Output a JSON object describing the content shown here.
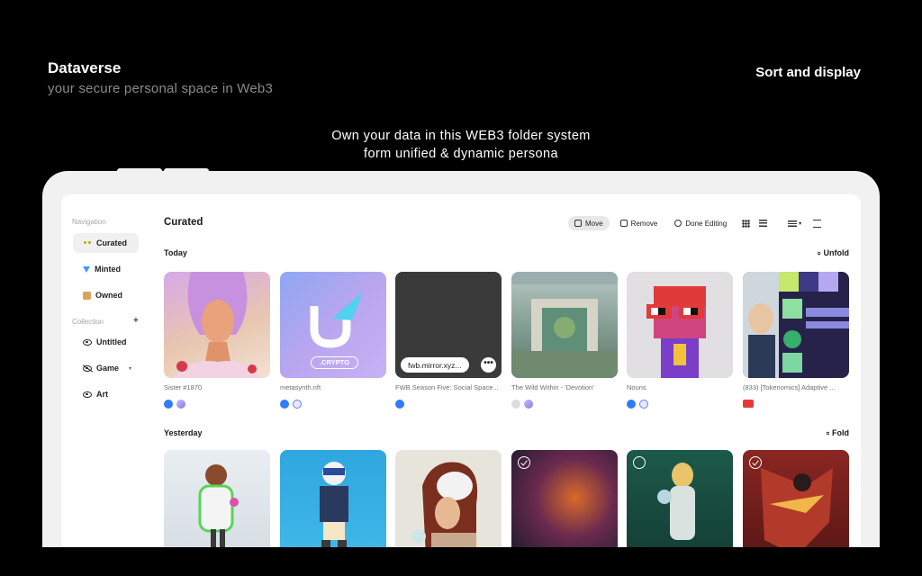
{
  "hero": {
    "title": "Dataverse",
    "subtitle": "your secure personal space in Web3",
    "right_label": "Sort and display",
    "tagline_line1": "Own your data in this WEB3 folder system",
    "tagline_line2": "form unified & dynamic persona"
  },
  "sidebar": {
    "navigation_label": "Navigation",
    "nav_items": [
      {
        "label": "Curated",
        "icon": "eyes-icon"
      },
      {
        "label": "Minted",
        "icon": "gem-icon"
      },
      {
        "label": "Owned",
        "icon": "box-icon"
      }
    ],
    "collection_label": "Collection",
    "add_symbol": "+",
    "collection_items": [
      {
        "label": "Untitled",
        "icon": "eye-icon"
      },
      {
        "label": "Game",
        "icon": "eye-off-icon"
      },
      {
        "label": "Art",
        "icon": "eye-icon"
      }
    ],
    "caret": "▾"
  },
  "main": {
    "title": "Curated",
    "toolbar": {
      "move": "Move",
      "remove": "Remove",
      "done": "Done Editing",
      "sort_caret": "▾"
    },
    "sections": {
      "today": "Today",
      "today_action": "Unfold",
      "yesterday": "Yesterday",
      "yesterday_action": "Fold",
      "today_action_icon": "»",
      "yesterday_action_icon": "»"
    },
    "today_cards": [
      {
        "label": "Sister #1870"
      },
      {
        "label": "metasynth.nft",
        "tag": ".CRYPTO"
      },
      {
        "label": "FWB Season Five: Social Space...",
        "pill": "fwb.mirror.xyz...",
        "more": "•••"
      },
      {
        "label": "The Wild Within - 'Devotion'"
      },
      {
        "label": "Nouns"
      },
      {
        "label": "(833) [Tokenomics] Adaptive ..."
      }
    ]
  },
  "colors": {
    "background": "#000000",
    "device": "#f1f1f1",
    "accent_blue": "#2f7cf6",
    "youtube_red": "#e53935"
  }
}
